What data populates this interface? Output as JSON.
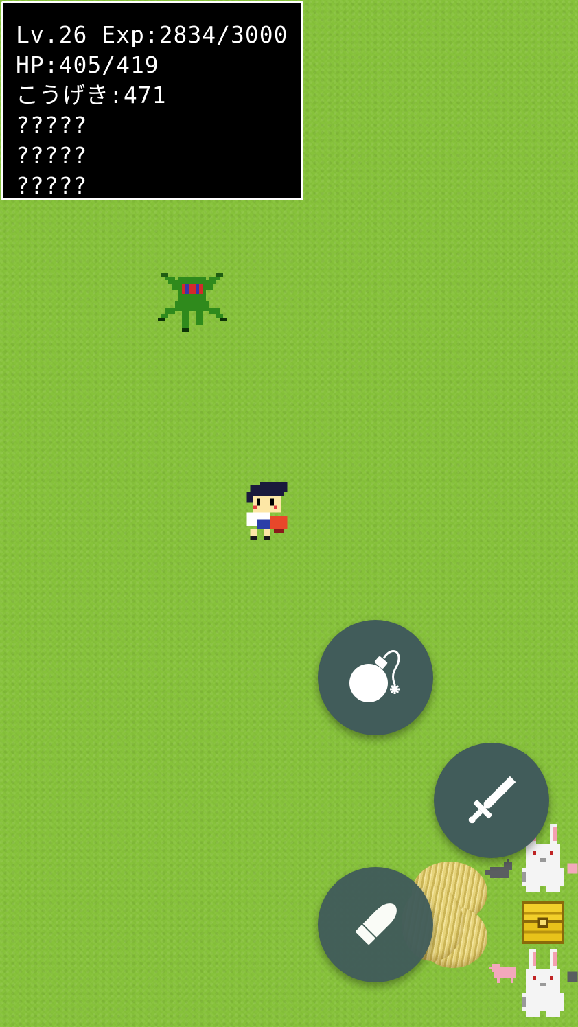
{
  "stats": {
    "line1": "Lv.26 Exp:2834/3000",
    "line2": "HP:405/419",
    "line3": "こうげき:471",
    "line4": "?????",
    "line5": "?????",
    "line6": "?????"
  },
  "player": {
    "level": 26,
    "exp": 2834,
    "exp_max": 3000,
    "hp": 405,
    "hp_max": 419,
    "attack": 471
  },
  "buttons": [
    {
      "name": "bomb-button",
      "icon": "bomb-icon"
    },
    {
      "name": "sword-button",
      "icon": "sword-icon"
    },
    {
      "name": "bullet-button",
      "icon": "bullet-icon"
    }
  ],
  "colors": {
    "grass": "#86c23a",
    "panel": "#000000",
    "panel_text": "#ffffff",
    "fab": "#415c5a",
    "goblin": "#2f8a1c",
    "goblin_eyes": "#d42a2a",
    "chest": "#e8c21a"
  }
}
